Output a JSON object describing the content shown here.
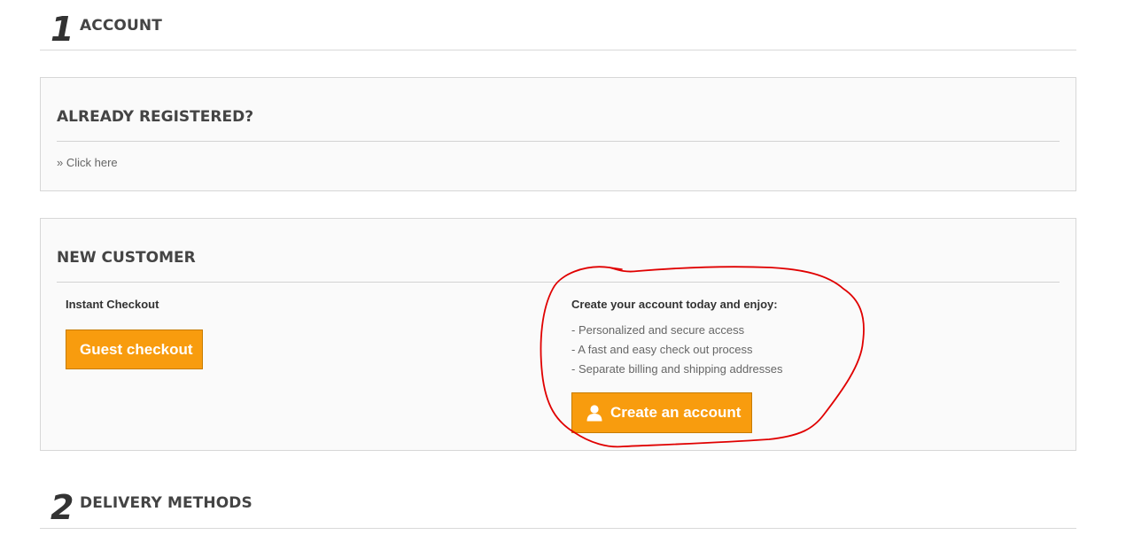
{
  "steps": [
    {
      "number": "1",
      "title": "ACCOUNT"
    },
    {
      "number": "2",
      "title": "DELIVERY METHODS"
    }
  ],
  "registered": {
    "title": "ALREADY REGISTERED?",
    "link_text": "» Click here"
  },
  "new_customer": {
    "title": "NEW CUSTOMER",
    "instant_checkout_label": "Instant Checkout",
    "guest_button_label": "Guest checkout",
    "create_heading": "Create your account today and enjoy:",
    "benefits": [
      "- Personalized and secure access",
      "- A fast and easy check out process",
      "- Separate billing and shipping addresses"
    ],
    "create_button_label": "Create an account",
    "create_button_icon": "user-icon"
  },
  "colors": {
    "button_orange": "#f89c0e",
    "annotation_red": "#e00000"
  }
}
